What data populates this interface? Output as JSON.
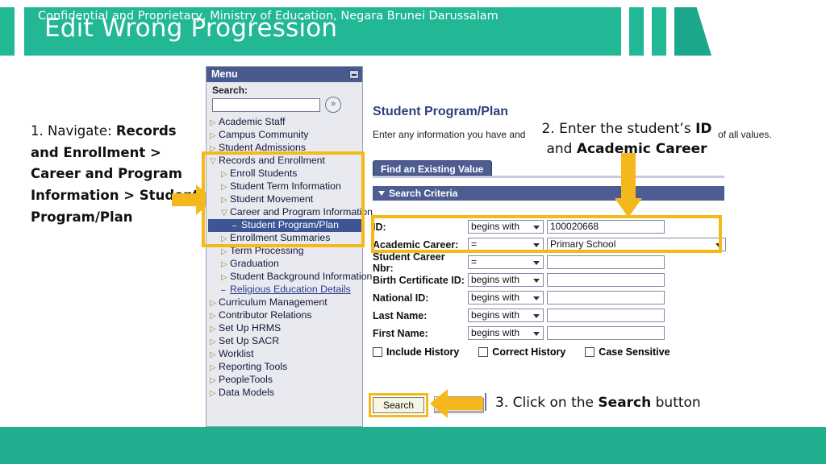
{
  "header": {
    "title": "Edit Wrong Progression",
    "brand_color": "#22b795",
    "wedge_color": "#1aa78a"
  },
  "footer": {
    "text": "Confidential and Proprietary, Ministry of Education, Negara Brunei Darussalam",
    "color": "#1fae8e"
  },
  "annotations": {
    "step1": "1. Navigate: Records and Enrollment > Career and Program Information > Student Program/Plan",
    "step1_prefix": "1. Navigate: ",
    "step1_path": "Records and Enrollment > Career and Program Information > Student Program/Plan",
    "step2_line1_prefix": "2. Enter the student’s ",
    "step2_line1_bold": "ID",
    "step2_line2_prefix": "and ",
    "step2_line2_bold": "Academic Career",
    "step3_prefix": "3. Click on the ",
    "step3_bold": "Search",
    "step3_suffix": " button",
    "highlight_color": "#f6ba18",
    "arrow_color": "#f5b81c"
  },
  "menu": {
    "panel_title": "Menu",
    "search_label": "Search:",
    "search_value": "",
    "search_go_icon": "double-chevron-right-icon",
    "collapse_icon": "minimize-icon",
    "items": [
      {
        "label": "Academic Staff",
        "level": 1,
        "marker": "collapsed",
        "state": "normal"
      },
      {
        "label": "Campus Community",
        "level": 1,
        "marker": "collapsed",
        "state": "normal"
      },
      {
        "label": "Student Admissions",
        "level": 1,
        "marker": "collapsed",
        "state": "normal"
      },
      {
        "label": "Records and Enrollment",
        "level": 1,
        "marker": "expanded",
        "state": "normal"
      },
      {
        "label": "Enroll Students",
        "level": 2,
        "marker": "collapsed",
        "state": "normal"
      },
      {
        "label": "Student Term Information",
        "level": 2,
        "marker": "collapsed",
        "state": "normal"
      },
      {
        "label": "Student Movement",
        "level": 2,
        "marker": "collapsed",
        "state": "normal"
      },
      {
        "label": "Career and Program Information",
        "level": 2,
        "marker": "expanded",
        "state": "normal"
      },
      {
        "label": "Student Program/Plan",
        "level": 3,
        "marker": "leaf",
        "state": "selected"
      },
      {
        "label": "Enrollment Summaries",
        "level": 2,
        "marker": "collapsed",
        "state": "normal"
      },
      {
        "label": "Term Processing",
        "level": 2,
        "marker": "collapsed",
        "state": "normal"
      },
      {
        "label": "Graduation",
        "level": 2,
        "marker": "collapsed",
        "state": "normal"
      },
      {
        "label": "Student Background Information",
        "level": 2,
        "marker": "collapsed",
        "state": "normal"
      },
      {
        "label": "Religious Education Details",
        "level": 2,
        "marker": "leaf",
        "state": "link"
      },
      {
        "label": "Curriculum Management",
        "level": 1,
        "marker": "collapsed",
        "state": "normal"
      },
      {
        "label": "Contributor Relations",
        "level": 1,
        "marker": "collapsed",
        "state": "normal"
      },
      {
        "label": "Set Up HRMS",
        "level": 1,
        "marker": "collapsed",
        "state": "normal"
      },
      {
        "label": "Set Up SACR",
        "level": 1,
        "marker": "collapsed",
        "state": "normal"
      },
      {
        "label": "Worklist",
        "level": 1,
        "marker": "collapsed",
        "state": "normal"
      },
      {
        "label": "Reporting Tools",
        "level": 1,
        "marker": "collapsed",
        "state": "normal"
      },
      {
        "label": "PeopleTools",
        "level": 1,
        "marker": "collapsed",
        "state": "normal"
      },
      {
        "label": "Data Models",
        "level": 1,
        "marker": "collapsed",
        "state": "normal"
      }
    ]
  },
  "page": {
    "title": "Student Program/Plan",
    "intro_left": "Enter any information you have and",
    "intro_right": "of all values.",
    "tab_label": "Find an Existing Value",
    "section_label": "Search Criteria",
    "accent_color": "#4d5d91",
    "fields": [
      {
        "label": "ID:",
        "operator": "begins with",
        "value": "100020668",
        "value_type": "text"
      },
      {
        "label": "Academic Career:",
        "operator": "=",
        "value": "Primary School",
        "value_type": "select"
      },
      {
        "label": "Student Career Nbr:",
        "operator": "=",
        "value": "",
        "value_type": "text"
      },
      {
        "label": "Birth Certificate ID:",
        "operator": "begins with",
        "value": "",
        "value_type": "text"
      },
      {
        "label": "National ID:",
        "operator": "begins with",
        "value": "",
        "value_type": "text"
      },
      {
        "label": "Last Name:",
        "operator": "begins with",
        "value": "",
        "value_type": "text"
      },
      {
        "label": "First Name:",
        "operator": "begins with",
        "value": "",
        "value_type": "text"
      }
    ],
    "checkboxes": [
      {
        "label": "Include History",
        "checked": false
      },
      {
        "label": "Correct History",
        "checked": false
      },
      {
        "label": "Case Sensitive",
        "checked": false
      }
    ],
    "search_button": "Search"
  }
}
